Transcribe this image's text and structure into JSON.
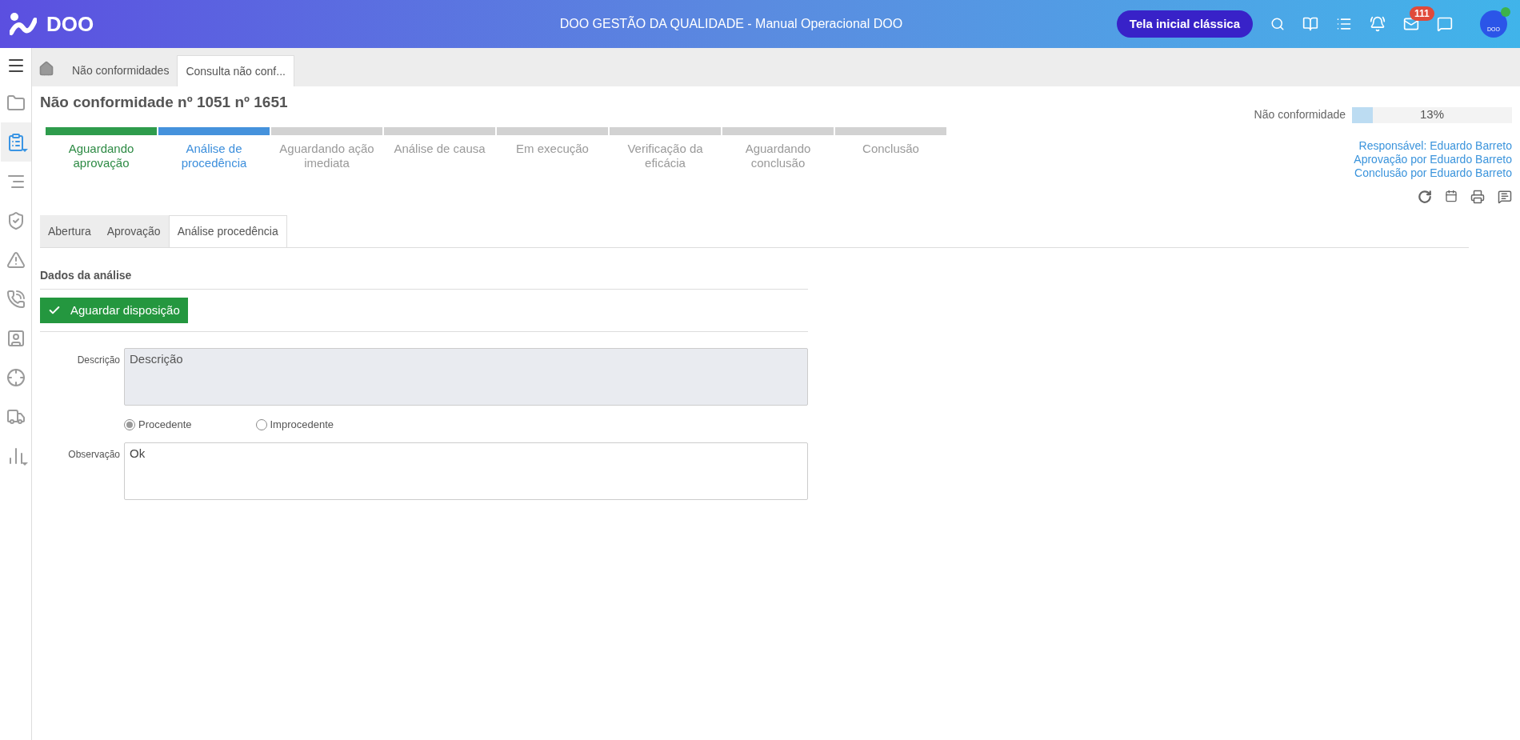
{
  "header": {
    "logo_text": "DOO",
    "title": "DOO GESTÃO DA QUALIDADE - Manual Operacional DOO",
    "classic_button": "Tela inicial clássica",
    "mail_badge": "111",
    "avatar_text": "DOO"
  },
  "sidebar": {
    "items": [
      {
        "selected": false
      },
      {
        "selected": true
      },
      {
        "selected": false
      },
      {
        "selected": false
      },
      {
        "selected": false
      },
      {
        "selected": false
      },
      {
        "selected": false
      },
      {
        "selected": false
      },
      {
        "selected": false
      },
      {
        "selected": false
      }
    ]
  },
  "page_tabs": [
    {
      "label": "Não conformidades",
      "selected": false
    },
    {
      "label": "Consulta não conf...",
      "selected": true
    }
  ],
  "title": "Não conformidade nº 1051 nº 1651",
  "steps": [
    {
      "label": "Aguardando aprovação",
      "kind": "done"
    },
    {
      "label": "Análise de procedência",
      "kind": "current"
    },
    {
      "label": "Aguardando ação imediata",
      "kind": "pending"
    },
    {
      "label": "Análise de causa",
      "kind": "pending"
    },
    {
      "label": "Em execução",
      "kind": "pending"
    },
    {
      "label": "Verificação da eficácia",
      "kind": "pending"
    },
    {
      "label": "Aguardando conclusão",
      "kind": "pending"
    },
    {
      "label": "Conclusão",
      "kind": "pending"
    }
  ],
  "progress": {
    "label": "Não conformidade",
    "level": 0.13,
    "reading": "13%"
  },
  "people": [
    "Responsável: Eduardo Barreto",
    "Aprovação por Eduardo Barreto",
    "Conclusão por Eduardo Barreto"
  ],
  "form_tabs": [
    {
      "label": "Abertura",
      "selected": false
    },
    {
      "label": "Aprovação",
      "selected": false
    },
    {
      "label": "Análise procedência",
      "selected": true
    }
  ],
  "section_title": "Dados da análise",
  "action_button": "Aguardar disposição",
  "description": {
    "label": "Descrição",
    "placeholder": "Descrição"
  },
  "options": [
    {
      "label": "Procedente",
      "selected": true
    },
    {
      "label": "Improcedente",
      "selected": false
    }
  ],
  "observation": {
    "label": "Observação",
    "value": "Ok"
  }
}
